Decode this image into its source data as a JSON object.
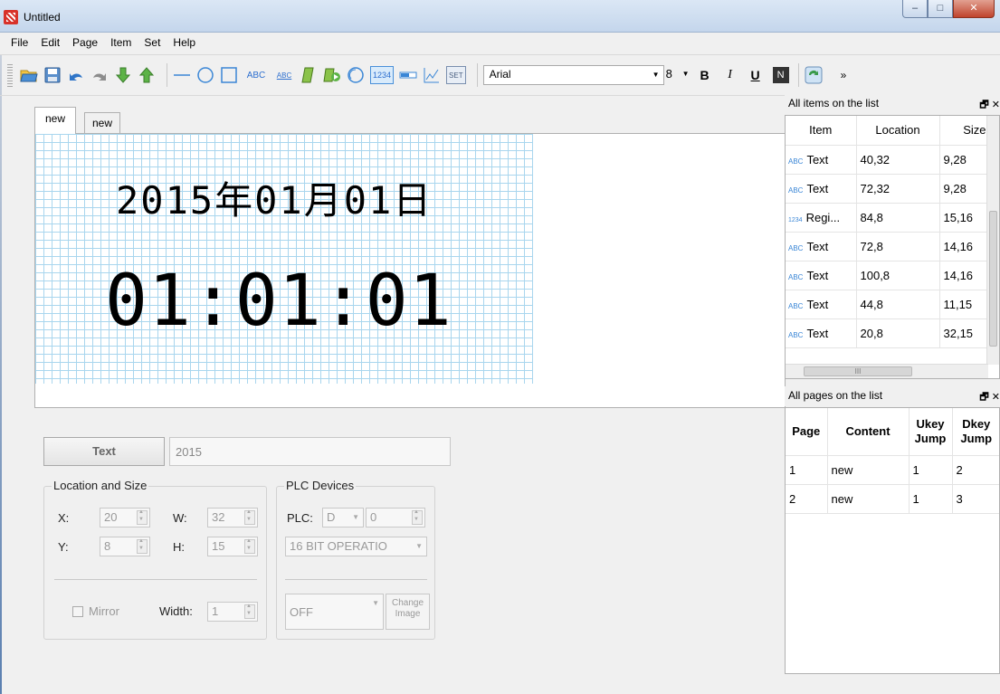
{
  "window": {
    "title": "Untitled",
    "controls": {
      "minimize": "–",
      "maximize": "□",
      "close": "✕"
    }
  },
  "menu": [
    "File",
    "Edit",
    "Page",
    "Item",
    "Set",
    "Help"
  ],
  "toolbar": {
    "abc_label": "ABC",
    "abc2_label": "ABC",
    "num_label": "1234",
    "set_label": "SET",
    "font": "Arial",
    "font_size": "8",
    "bold": "B",
    "italic": "I",
    "underline": "U",
    "normal": "N",
    "more": "»",
    "icons": [
      "open-folder-icon",
      "save-icon",
      "undo-icon",
      "redo-icon",
      "move-down-icon",
      "move-up-icon",
      "line-icon",
      "circle-icon",
      "rectangle-icon",
      "text-abc-icon",
      "dynamic-text-icon",
      "bitmap-icon",
      "animation-icon",
      "gauge-icon",
      "register-icon",
      "bar-icon",
      "trend-icon",
      "set-icon",
      "refresh-icon"
    ]
  },
  "editor": {
    "tabs": [
      "new",
      "new"
    ],
    "lcd_date": "2015年01月01日",
    "lcd_time": "01:01:01"
  },
  "properties": {
    "type_button": "Text",
    "text_value": "2015",
    "location_group": "Location and Size",
    "x_label": "X:",
    "x_value": "20",
    "y_label": "Y:",
    "y_value": "8",
    "w_label": "W:",
    "w_value": "32",
    "h_label": "H:",
    "h_value": "15",
    "mirror_label": "Mirror",
    "width_label": "Width:",
    "width_value": "1",
    "plc_group": "PLC Devices",
    "plc_label": "PLC:",
    "plc_device": "D",
    "plc_address": "0",
    "operation": "16 BIT OPERATIO",
    "state": "OFF",
    "change_image": "Change Image"
  },
  "items_panel": {
    "title": "All items on the list",
    "dock_buttons": "🗗 ✕",
    "columns": [
      "Item",
      "Location",
      "Size"
    ],
    "rows": [
      {
        "icon": "ABC",
        "item": "Text",
        "location": "40,32",
        "size": "9,28"
      },
      {
        "icon": "ABC",
        "item": "Text",
        "location": "72,32",
        "size": "9,28"
      },
      {
        "icon": "1234",
        "item": "Regi...",
        "location": "84,8",
        "size": "15,16"
      },
      {
        "icon": "ABC",
        "item": "Text",
        "location": "72,8",
        "size": "14,16"
      },
      {
        "icon": "ABC",
        "item": "Text",
        "location": "100,8",
        "size": "14,16"
      },
      {
        "icon": "ABC",
        "item": "Text",
        "location": "44,8",
        "size": "11,15"
      },
      {
        "icon": "ABC",
        "item": "Text",
        "location": "20,8",
        "size": "32,15"
      }
    ],
    "scroll_thumb": "III"
  },
  "pages_panel": {
    "title": "All pages on the list",
    "dock_buttons": "🗗 ✕",
    "columns": [
      "Page",
      "Content",
      "Ukey Jump",
      "Dkey Jump"
    ],
    "rows": [
      {
        "page": "1",
        "content": "new",
        "ukey": "1",
        "dkey": "2"
      },
      {
        "page": "2",
        "content": "new",
        "ukey": "1",
        "dkey": "3"
      }
    ]
  }
}
